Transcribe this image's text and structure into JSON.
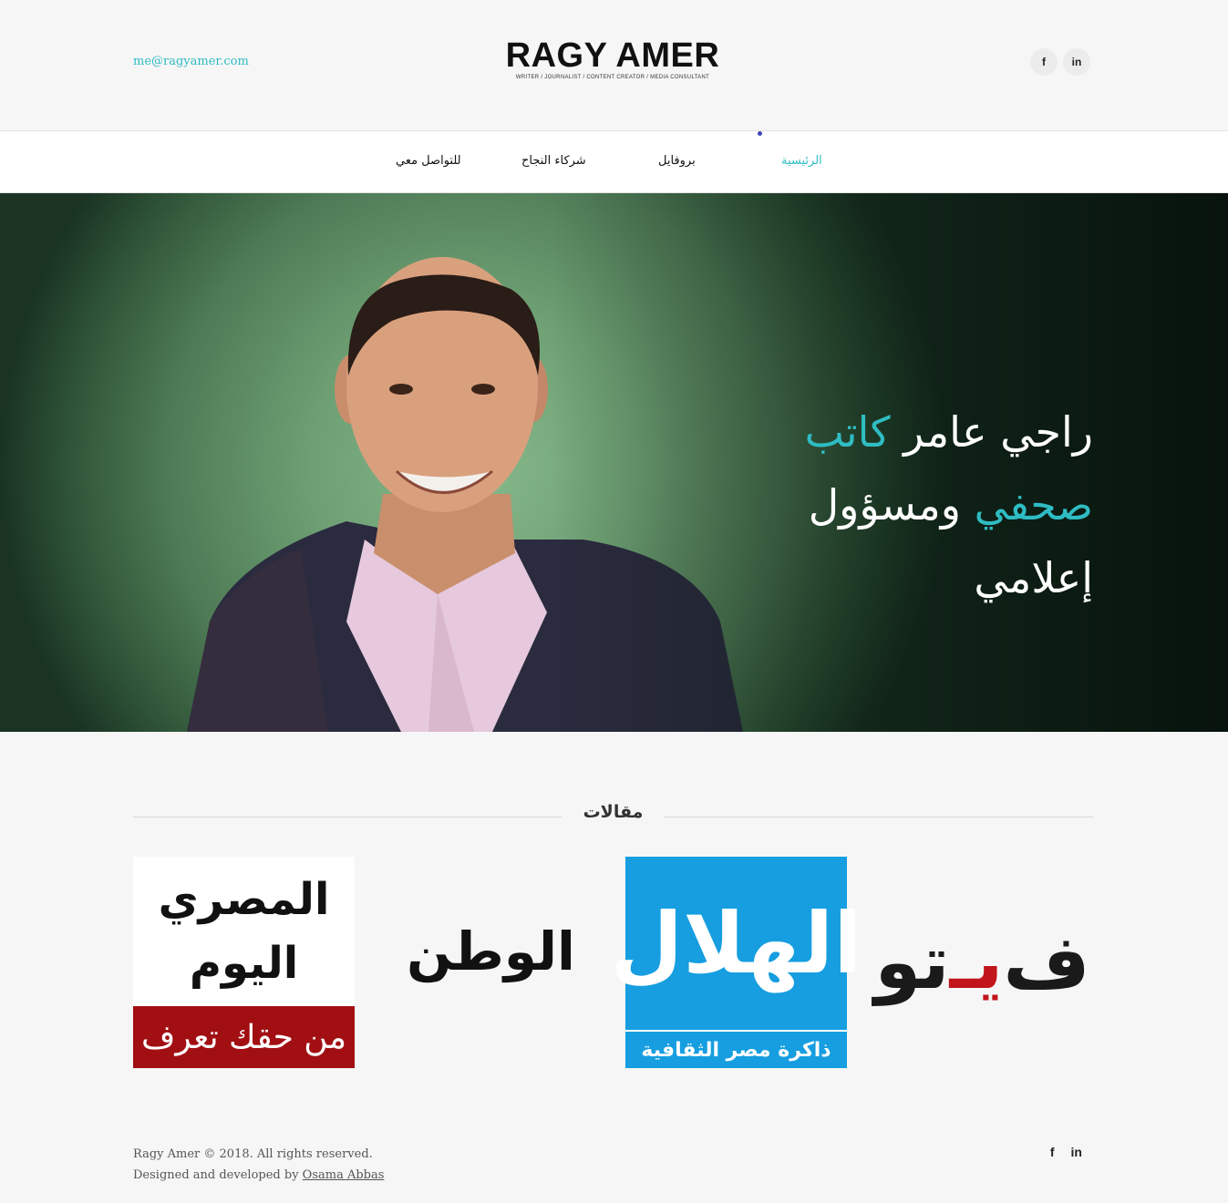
{
  "header": {
    "email": "me@ragyamer.com",
    "logo_title": "RAGY AMER",
    "logo_subtitle": "WRITER / JOURNALIST / CONTENT CREATOR / MEDIA CONSULTANT",
    "social": [
      {
        "icon": "facebook-icon",
        "glyph": "f"
      },
      {
        "icon": "linkedin-icon",
        "glyph": "in"
      }
    ]
  },
  "nav": {
    "items": [
      {
        "label": "الرئيسية",
        "active": true
      },
      {
        "label": "بروفايل",
        "active": false
      },
      {
        "label": "شركاء النجاح",
        "active": false
      },
      {
        "label": "للتواصل معي",
        "active": false
      }
    ]
  },
  "hero": {
    "line1_plain": "راجي عامر",
    "line1_highlight": "كاتب",
    "line2_highlight": "صحفي",
    "line2_plain": "ومسؤول",
    "line3": "إعلامي",
    "highlight_color": "#2fbcc3"
  },
  "articles": {
    "title": "مقالات",
    "logos": [
      {
        "name": "almasry-alyoum",
        "line1": "المصري",
        "line2": "اليوم",
        "tagline": "من حقك تعرف"
      },
      {
        "name": "elwatan",
        "text": "الوطن"
      },
      {
        "name": "alhilal",
        "text": "الهلال",
        "tagline": "ذاكرة مصر الثقافية"
      },
      {
        "name": "veto",
        "text_start": "ف",
        "text_mid": "يـ",
        "text_end": "تو"
      }
    ]
  },
  "footer": {
    "copyright": "Ragy Amer © 2018. All rights reserved.",
    "designed_prefix": "Designed and developed by ",
    "designer": "Osama Abbas",
    "social": [
      {
        "icon": "facebook-icon",
        "glyph": "f"
      },
      {
        "icon": "linkedin-icon",
        "glyph": "in"
      }
    ]
  }
}
